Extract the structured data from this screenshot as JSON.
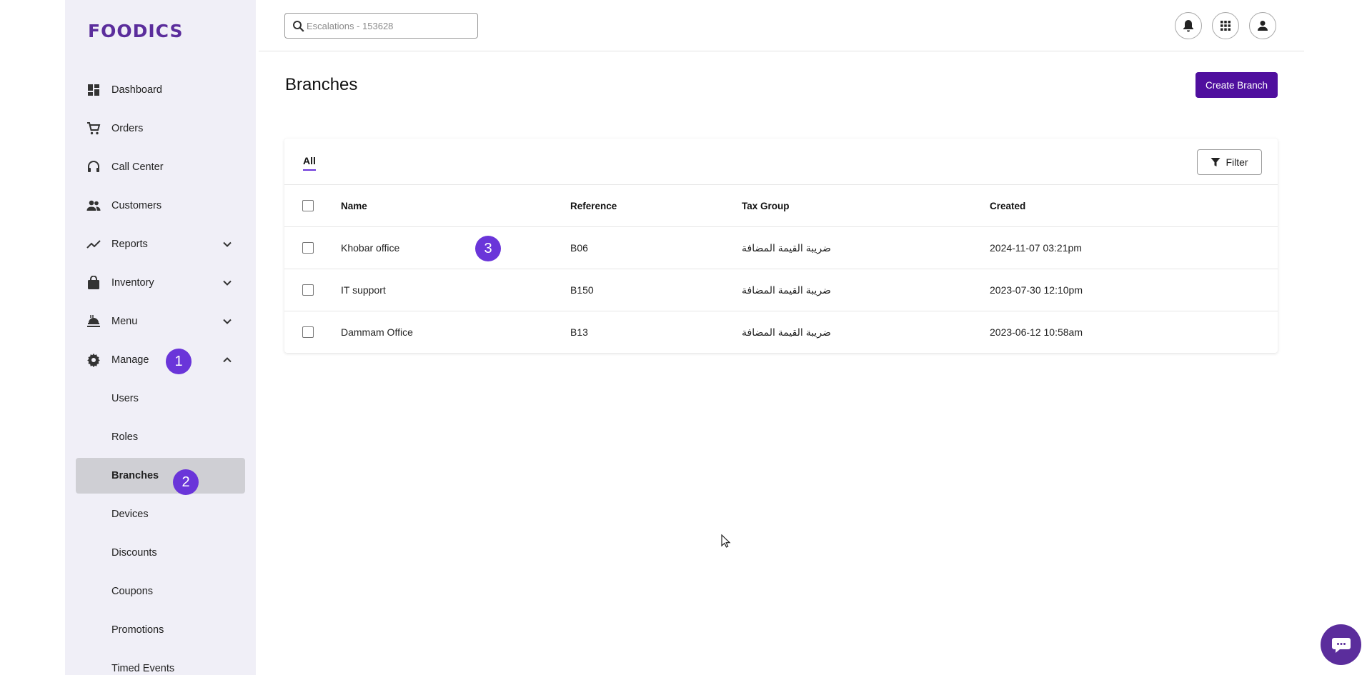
{
  "brand": {
    "logo_text": "FOODICS",
    "accent": "#5b2d9c",
    "primary_button": "#4f0f9e",
    "badge_color": "#6a35d9"
  },
  "sidebar": {
    "items": [
      {
        "label": "Dashboard",
        "icon": "dashboard-icon"
      },
      {
        "label": "Orders",
        "icon": "cart-icon"
      },
      {
        "label": "Call Center",
        "icon": "headset-icon"
      },
      {
        "label": "Customers",
        "icon": "people-icon"
      },
      {
        "label": "Reports",
        "icon": "trend-icon",
        "expandable": true,
        "expanded": false
      },
      {
        "label": "Inventory",
        "icon": "bag-icon",
        "expandable": true,
        "expanded": false
      },
      {
        "label": "Menu",
        "icon": "food-icon",
        "expandable": true,
        "expanded": false
      },
      {
        "label": "Manage",
        "icon": "gear-icon",
        "expandable": true,
        "expanded": true
      }
    ],
    "sub_items": [
      {
        "label": "Users"
      },
      {
        "label": "Roles"
      },
      {
        "label": "Branches",
        "active": true
      },
      {
        "label": "Devices"
      },
      {
        "label": "Discounts"
      },
      {
        "label": "Coupons"
      },
      {
        "label": "Promotions"
      },
      {
        "label": "Timed Events"
      }
    ]
  },
  "header": {
    "search": {
      "placeholder": "Escalations - 153628",
      "value": ""
    },
    "icons": [
      "bell-icon",
      "apps-grid-icon",
      "user-icon"
    ]
  },
  "page": {
    "title": "Branches",
    "create_button": "Create Branch"
  },
  "card": {
    "tabs": [
      {
        "label": "All",
        "active": true
      }
    ],
    "filter_label": "Filter",
    "columns": [
      "Name",
      "Reference",
      "Tax Group",
      "Created"
    ],
    "rows": [
      {
        "name": "Khobar office",
        "reference": "B06",
        "tax_group": "ضريبة القيمة المضافة",
        "created": "2024-11-07 03:21pm"
      },
      {
        "name": "IT support",
        "reference": "B150",
        "tax_group": "ضريبة القيمة المضافة",
        "created": "2023-07-30 12:10pm"
      },
      {
        "name": "Dammam Office",
        "reference": "B13",
        "tax_group": "ضريبة القيمة المضافة",
        "created": "2023-06-12 10:58am"
      }
    ]
  },
  "step_badges": [
    "1",
    "2",
    "3"
  ]
}
